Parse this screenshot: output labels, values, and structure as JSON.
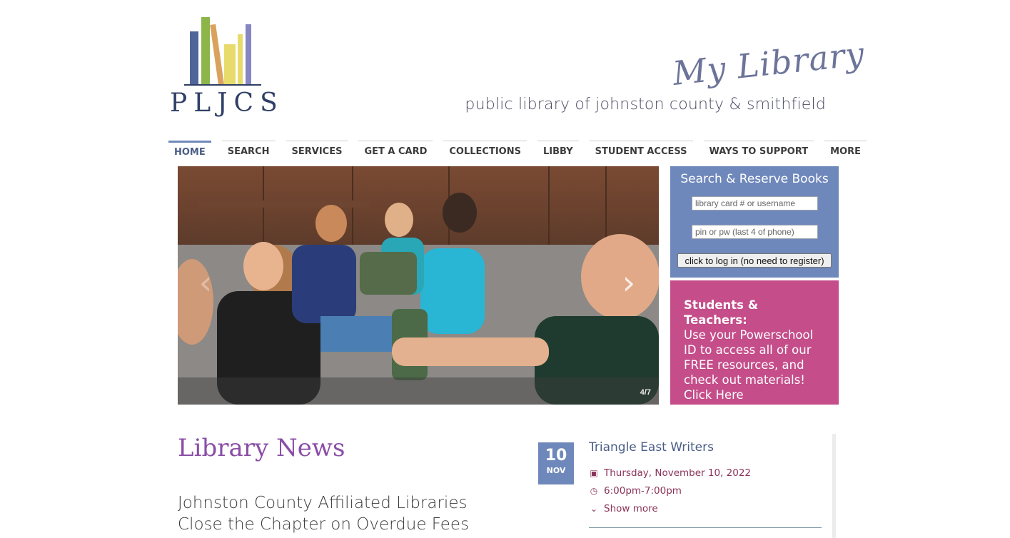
{
  "header": {
    "logo_text": "PLJCS",
    "script_title": "My Library",
    "tagline": "public library of johnston county & smithfield"
  },
  "nav": {
    "items": [
      {
        "label": "HOME",
        "active": true
      },
      {
        "label": "SEARCH"
      },
      {
        "label": "SERVICES"
      },
      {
        "label": "GET A CARD"
      },
      {
        "label": "COLLECTIONS"
      },
      {
        "label": "LIBBY"
      },
      {
        "label": "STUDENT ACCESS"
      },
      {
        "label": "WAYS TO SUPPORT"
      },
      {
        "label": "MORE"
      }
    ]
  },
  "slider": {
    "counter": "4/7",
    "prev_icon": "chevron-left-icon",
    "next_icon": "chevron-right-icon"
  },
  "login": {
    "title": "Search & Reserve Books",
    "user_placeholder": "library card # or username",
    "pin_placeholder": "pin or pw (last 4 of phone)",
    "button_label": "click to log in (no need to register)"
  },
  "students": {
    "heading": "Students & Teachers:",
    "body": "Use your Powerschool ID to access all of our FREE resources, and check out materials! Click Here"
  },
  "news": {
    "title": "Library News",
    "headline": "Johnston County Affiliated Libraries Close the Chapter on Overdue Fees"
  },
  "event": {
    "day": "10",
    "month": "NOV",
    "title": "Triangle East Writers",
    "date": "Thursday, November 10, 2022",
    "time": "6:00pm-7:00pm",
    "more_label": "Show more"
  },
  "colors": {
    "accent_blue": "#6f88bb",
    "accent_pink": "#c44d8a",
    "news_purple": "#8a4ea6",
    "event_text": "#8a3358"
  }
}
